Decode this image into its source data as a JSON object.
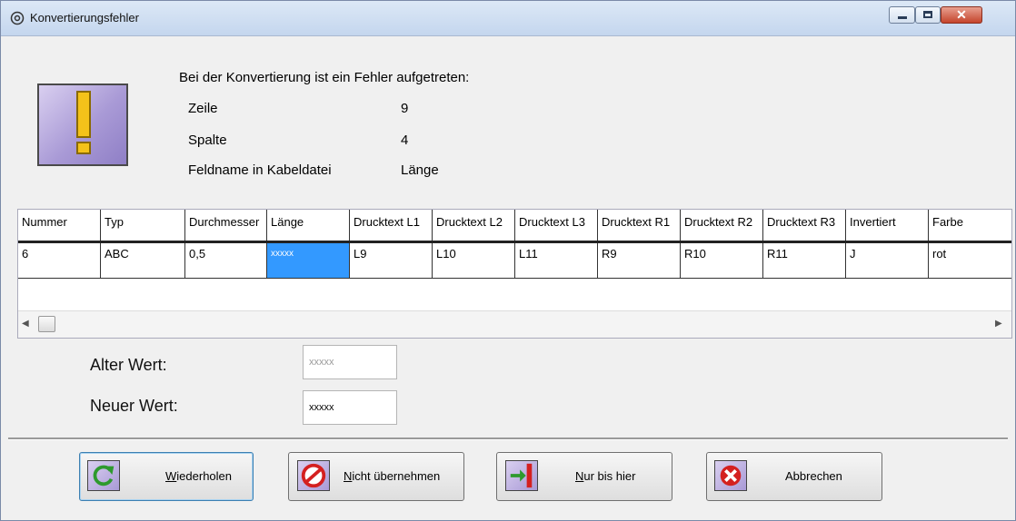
{
  "window": {
    "title": "Konvertierungsfehler"
  },
  "message": "Bei der Konvertierung ist ein Fehler aufgetreten:",
  "info": [
    {
      "label": "Zeile",
      "value": "9"
    },
    {
      "label": "Spalte",
      "value": "4"
    },
    {
      "label": "Feldname in Kabeldatei",
      "value": "Länge"
    }
  ],
  "table": {
    "columns": [
      "Nummer",
      "Typ",
      "Durchmesser",
      "Länge",
      "Drucktext L1",
      "Drucktext L2",
      "Drucktext L3",
      "Drucktext R1",
      "Drucktext R2",
      "Drucktext R3",
      "Invertiert",
      "Farbe"
    ],
    "rows": [
      [
        "6",
        "ABC",
        "0,5",
        "xxxxx",
        "L9",
        "L10",
        "L11",
        "R9",
        "R10",
        "R11",
        "J",
        "rot"
      ]
    ],
    "selected_column": "Länge"
  },
  "fields": {
    "old_label": "Alter Wert:",
    "old_value": "xxxxx",
    "new_label": "Neuer Wert:",
    "new_value": "xxxxx"
  },
  "buttons": {
    "retry": {
      "first": "W",
      "rest": "iederholen",
      "icon": "refresh-icon"
    },
    "skip": {
      "first": "N",
      "rest": "icht übernehmen",
      "icon": "no-entry-icon"
    },
    "until": {
      "first": "N",
      "rest": "ur bis hier",
      "icon": "arrow-to-bar-icon"
    },
    "cancel": {
      "label": "Abbrechen",
      "icon": "cancel-x-icon"
    }
  },
  "colors": {
    "selection": "#3399ff",
    "warning_yellow": "#f4c21a",
    "icon_purple": "#a99ad6"
  }
}
